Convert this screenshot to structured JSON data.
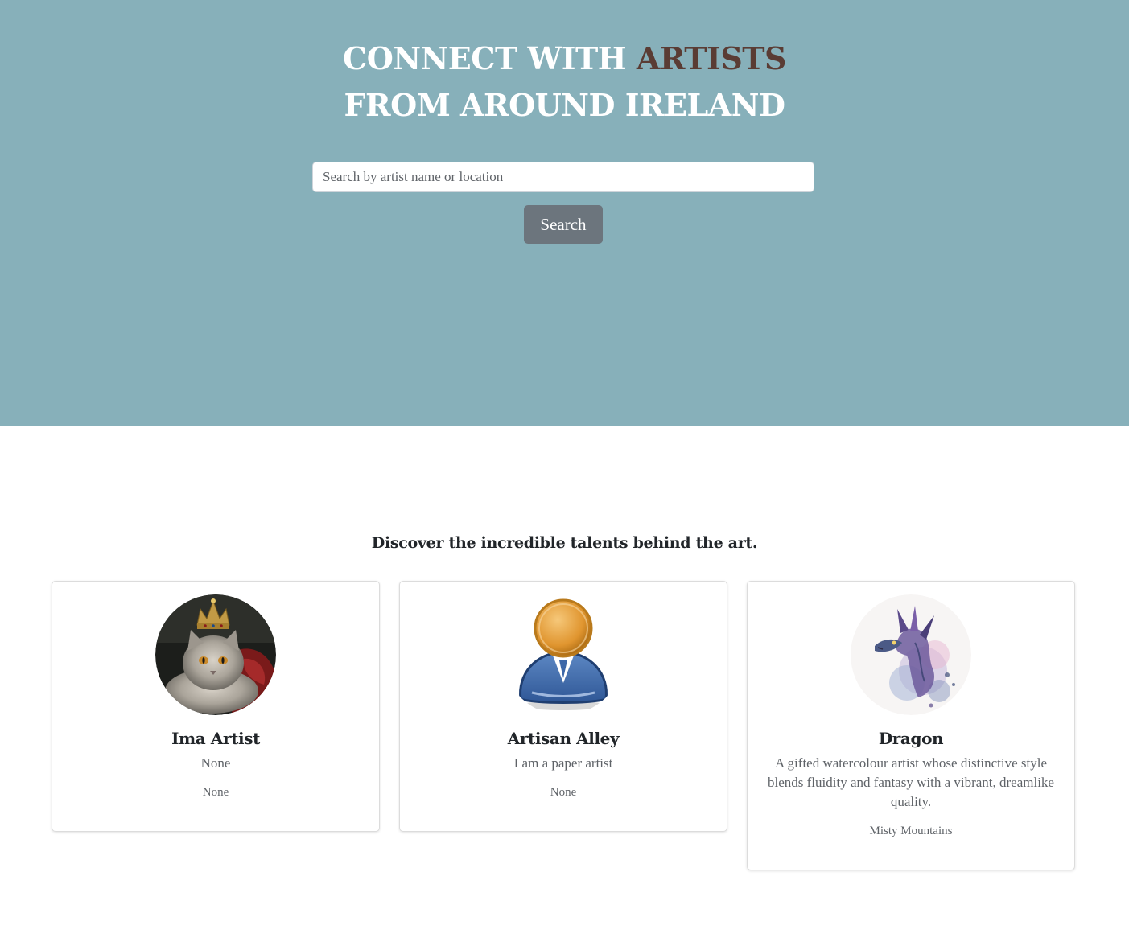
{
  "hero": {
    "title_part1": "CONNECT WITH ",
    "title_accent": "ARTISTS",
    "title_line2": "FROM AROUND IRELAND",
    "accent_color": "#5a3c34",
    "background_color": "#87b0ba"
  },
  "search": {
    "placeholder": "Search by artist name or location",
    "value": "",
    "button_label": "Search"
  },
  "tagline": "Discover the incredible talents behind the art.",
  "artists": [
    {
      "name": "Ima Artist",
      "bio": "None",
      "location": "None",
      "avatar_icon": "cat-with-crown-photo"
    },
    {
      "name": "Artisan Alley",
      "bio": "I am a paper artist",
      "location": "None",
      "avatar_icon": "default-user-icon"
    },
    {
      "name": "Dragon",
      "bio": "A gifted watercolour artist whose distinctive style blends fluidity and fantasy with a vibrant, dreamlike quality.",
      "location": "Misty Mountains",
      "avatar_icon": "watercolour-dragon-image"
    }
  ]
}
